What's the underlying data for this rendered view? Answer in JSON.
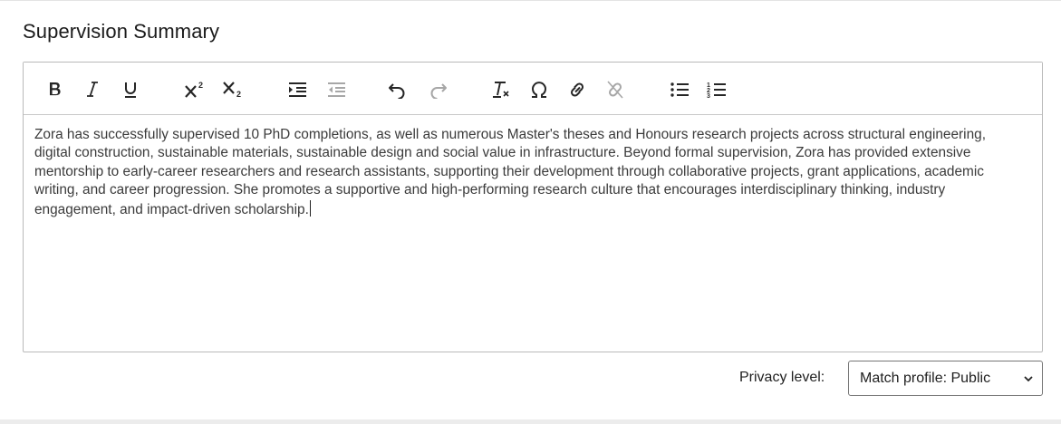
{
  "section": {
    "title": "Supervision Summary"
  },
  "toolbar": {
    "buttons": [
      {
        "icon": "bold-icon"
      },
      {
        "icon": "italic-icon"
      },
      {
        "icon": "underline-icon"
      },
      {
        "icon": "superscript-icon"
      },
      {
        "icon": "subscript-icon"
      },
      {
        "icon": "indent-icon"
      },
      {
        "icon": "outdent-icon",
        "disabled": true
      },
      {
        "icon": "undo-icon"
      },
      {
        "icon": "redo-icon",
        "disabled": true
      },
      {
        "icon": "clear-formatting-icon"
      },
      {
        "icon": "special-character-icon"
      },
      {
        "icon": "link-icon"
      },
      {
        "icon": "unlink-icon",
        "disabled": true
      },
      {
        "icon": "bulleted-list-icon"
      },
      {
        "icon": "numbered-list-icon"
      }
    ]
  },
  "editor": {
    "content": "Zora has successfully supervised 10 PhD completions, as well as numerous Master's theses and Honours research projects across structural engineering, digital construction, sustainable materials, sustainable design and social value in infrastructure. Beyond formal supervision, Zora has provided extensive mentorship to early-career researchers and research assistants, supporting their development through collaborative projects, grant applications, academic writing, and career progression. She promotes a supportive and high-performing research culture that encourages interdisciplinary thinking, industry engagement, and impact-driven scholarship."
  },
  "privacy": {
    "label": "Privacy level:",
    "selected": "Match profile: Public"
  },
  "colors": {
    "border": "#b9b9b9",
    "text": "#3b3b3b",
    "disabled_icon": "#a7a7a7"
  }
}
